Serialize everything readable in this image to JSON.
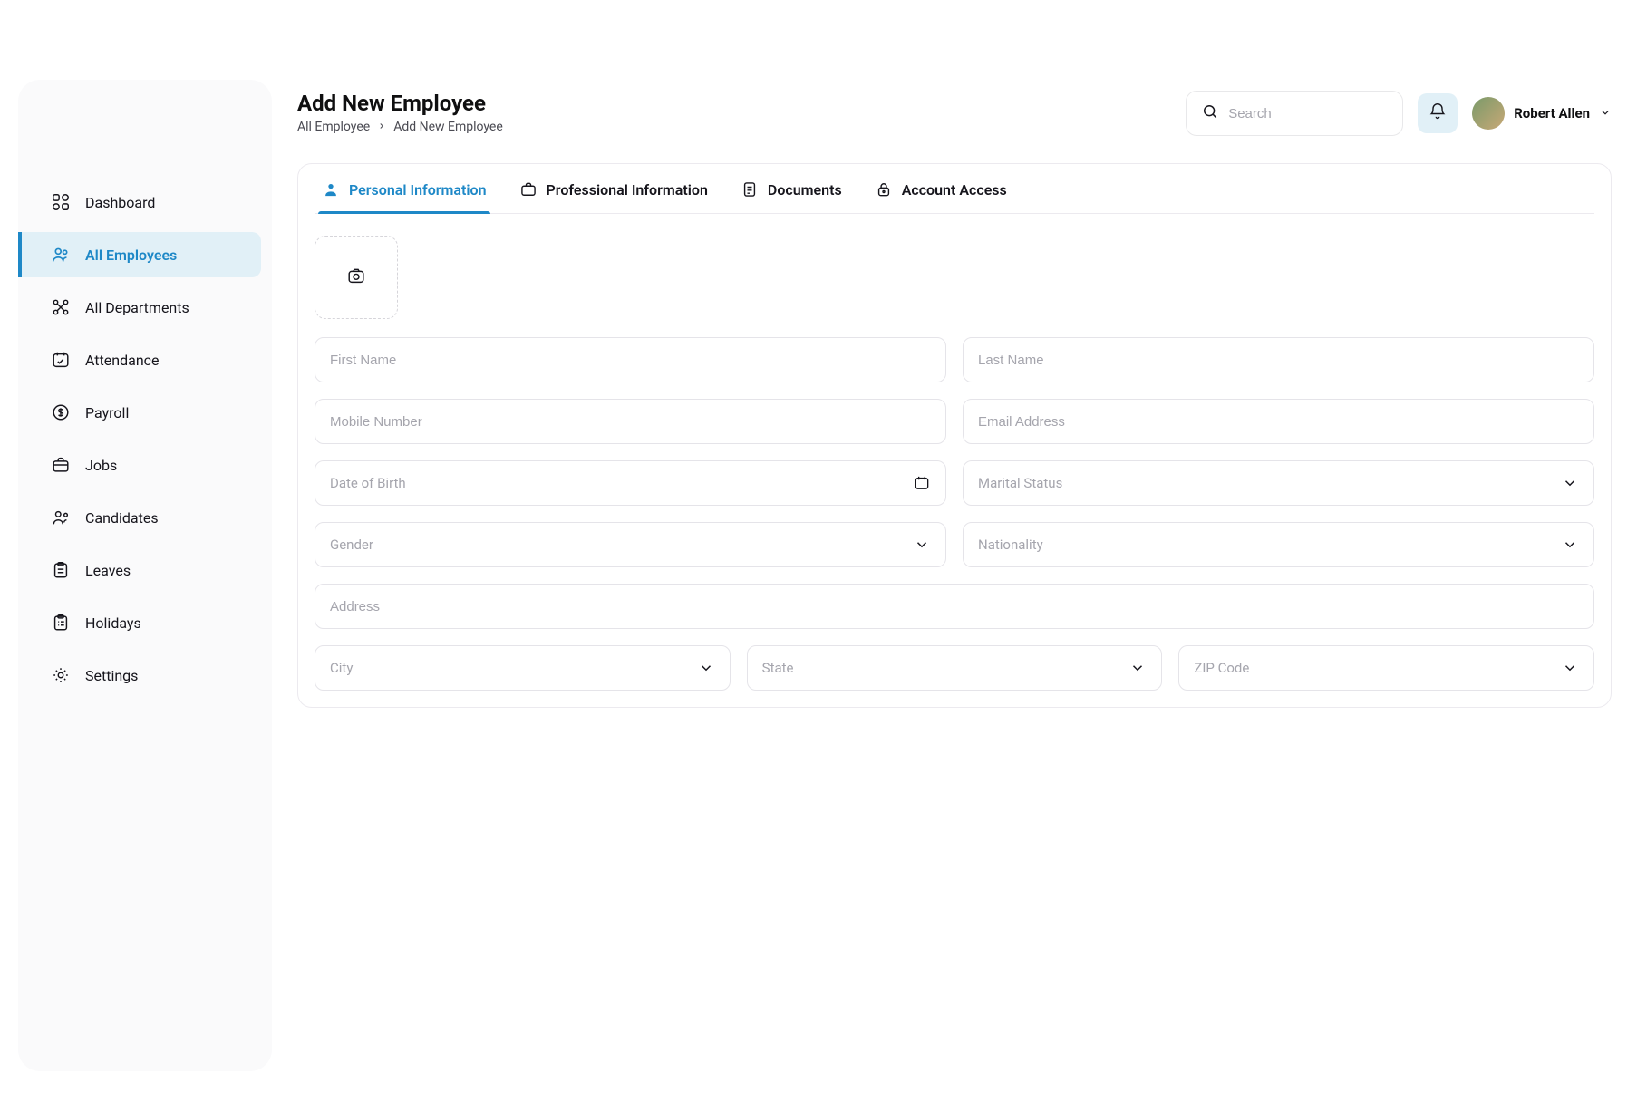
{
  "header": {
    "title": "Add New Employee",
    "breadcrumb": {
      "root": "All Employee",
      "current": "Add New Employee"
    },
    "search_placeholder": "Search",
    "user_name": "Robert Allen"
  },
  "sidebar": {
    "items": [
      {
        "label": "Dashboard"
      },
      {
        "label": "All Employees"
      },
      {
        "label": "All Departments"
      },
      {
        "label": "Attendance"
      },
      {
        "label": "Payroll"
      },
      {
        "label": "Jobs"
      },
      {
        "label": "Candidates"
      },
      {
        "label": "Leaves"
      },
      {
        "label": "Holidays"
      },
      {
        "label": "Settings"
      }
    ]
  },
  "tabs": [
    {
      "label": "Personal Information"
    },
    {
      "label": "Professional Information"
    },
    {
      "label": "Documents"
    },
    {
      "label": "Account Access"
    }
  ],
  "form": {
    "first_name": {
      "placeholder": "First Name"
    },
    "last_name": {
      "placeholder": "Last Name"
    },
    "mobile": {
      "placeholder": "Mobile Number"
    },
    "email": {
      "placeholder": "Email Address"
    },
    "dob": {
      "placeholder": "Date of Birth"
    },
    "marital": {
      "placeholder": "Marital Status"
    },
    "gender": {
      "placeholder": "Gender"
    },
    "nationality": {
      "placeholder": "Nationality"
    },
    "address": {
      "placeholder": "Address"
    },
    "city": {
      "placeholder": "City"
    },
    "state": {
      "placeholder": "State"
    },
    "zip": {
      "placeholder": "ZIP Code"
    }
  }
}
